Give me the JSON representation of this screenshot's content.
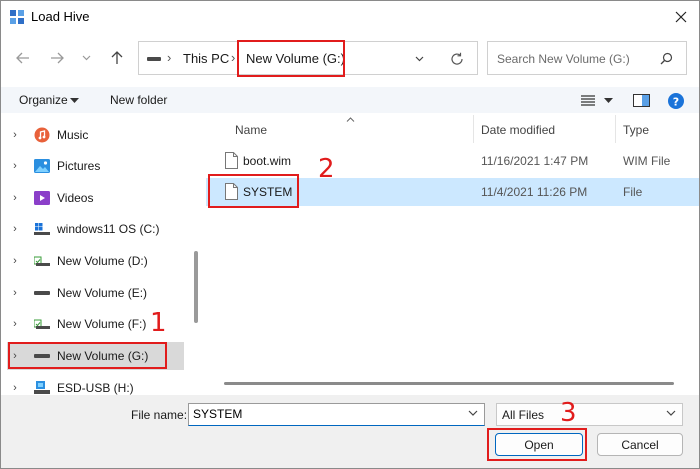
{
  "window": {
    "title": "Load Hive"
  },
  "address": {
    "crumbs": [
      "This PC",
      "New Volume (G:)"
    ],
    "search_placeholder": "Search New Volume (G:)"
  },
  "toolbar": {
    "organize": "Organize",
    "new_folder": "New folder"
  },
  "nav": {
    "items": [
      {
        "label": "Music",
        "icon": "music-icon"
      },
      {
        "label": "Pictures",
        "icon": "pictures-icon"
      },
      {
        "label": "Videos",
        "icon": "videos-icon"
      },
      {
        "label": "windows11 OS (C:)",
        "icon": "windows-drive-icon"
      },
      {
        "label": "New Volume (D:)",
        "icon": "drive-icon"
      },
      {
        "label": "New Volume (E:)",
        "icon": "drive-icon"
      },
      {
        "label": "New Volume (F:)",
        "icon": "drive-icon"
      },
      {
        "label": "New Volume (G:)",
        "icon": "drive-icon",
        "selected": true
      },
      {
        "label": "ESD-USB (H:)",
        "icon": "usb-drive-icon"
      }
    ]
  },
  "files": {
    "columns": {
      "name": "Name",
      "date": "Date modified",
      "type": "Type"
    },
    "rows": [
      {
        "name": "boot.wim",
        "date": "11/16/2021 1:47 PM",
        "type": "WIM File"
      },
      {
        "name": "SYSTEM",
        "date": "11/4/2021 11:26 PM",
        "type": "File",
        "selected": true
      }
    ]
  },
  "bottom": {
    "filename_label": "File name:",
    "filename_value": "SYSTEM",
    "filter_value": "All Files",
    "open_label": "Open",
    "cancel_label": "Cancel"
  },
  "annotations": {
    "step1": "1",
    "step2": "2",
    "step3": "3"
  },
  "colors": {
    "accent": "#0067c0",
    "selection": "#cce8ff",
    "annotation": "#e11c1c"
  }
}
